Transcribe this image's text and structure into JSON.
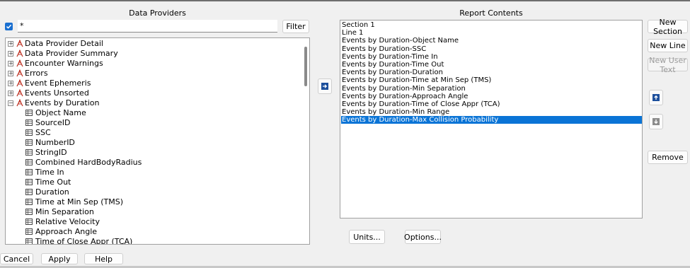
{
  "left_panel": {
    "title": "Data Providers",
    "filter_value": "*",
    "filter_button": "Filter",
    "tree": [
      {
        "label": "Data Provider Detail",
        "level": 0,
        "expanded": false
      },
      {
        "label": "Data Provider Summary",
        "level": 0,
        "expanded": false
      },
      {
        "label": "Encounter Warnings",
        "level": 0,
        "expanded": false
      },
      {
        "label": "Errors",
        "level": 0,
        "expanded": false
      },
      {
        "label": "Event Ephemeris",
        "level": 0,
        "expanded": false
      },
      {
        "label": "Events Unsorted",
        "level": 0,
        "expanded": false
      },
      {
        "label": "Events by Duration",
        "level": 0,
        "expanded": true
      },
      {
        "label": "Object Name",
        "level": 1
      },
      {
        "label": "SourceID",
        "level": 1
      },
      {
        "label": "SSC",
        "level": 1
      },
      {
        "label": "NumberID",
        "level": 1
      },
      {
        "label": "StringID",
        "level": 1
      },
      {
        "label": "Combined HardBodyRadius",
        "level": 1
      },
      {
        "label": "Time In",
        "level": 1
      },
      {
        "label": "Time Out",
        "level": 1
      },
      {
        "label": "Duration",
        "level": 1
      },
      {
        "label": "Time at Min Sep (TMS)",
        "level": 1
      },
      {
        "label": "Min Separation",
        "level": 1
      },
      {
        "label": "Relative Velocity",
        "level": 1
      },
      {
        "label": "Approach Angle",
        "level": 1
      },
      {
        "label": "Time of Close Appr (TCA)",
        "level": 1
      }
    ]
  },
  "right_panel": {
    "title": "Report Contents",
    "items": [
      "Section 1",
      "Line 1",
      "Events by Duration-Object Name",
      "Events by Duration-SSC",
      "Events by Duration-Time In",
      "Events by Duration-Time Out",
      "Events by Duration-Duration",
      "Events by Duration-Time at Min Sep (TMS)",
      "Events by Duration-Min Separation",
      "Events by Duration-Approach Angle",
      "Events by Duration-Time of Close Appr (TCA)",
      "Events by Duration-Min Range",
      "Events by Duration-Max Collision Probability"
    ],
    "selected_index": 12,
    "units_button": "Units...",
    "options_button": "Options..."
  },
  "side_buttons": {
    "new_section": "New Section",
    "new_line": "New Line",
    "new_user_text": "New User Text",
    "remove": "Remove"
  },
  "footer": {
    "cancel": "Cancel",
    "apply": "Apply",
    "help": "Help"
  },
  "colors": {
    "accent": "#0a74d6",
    "arrow_icon": "#1c4f9c",
    "provider_icon": "#c0392b"
  },
  "icons": {
    "add": "arrow-right-icon",
    "move_up": "arrow-up-icon",
    "move_down": "arrow-down-icon"
  }
}
